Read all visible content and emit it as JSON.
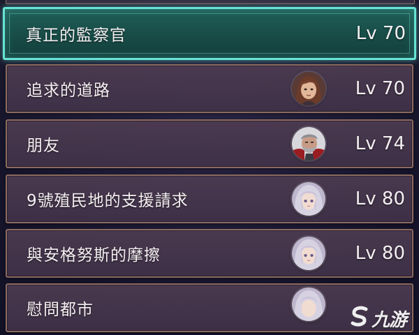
{
  "quests": [
    {
      "title": "真正的監察官",
      "level": "Lv 70",
      "selected": true,
      "portrait": "none"
    },
    {
      "title": "追求的道路",
      "level": "Lv 70",
      "selected": false,
      "portrait": "brown-haired-woman-portrait"
    },
    {
      "title": "朋友",
      "level": "Lv 74",
      "selected": false,
      "portrait": "bearded-man-portrait"
    },
    {
      "title": "9號殖民地的支援請求",
      "level": "Lv 80",
      "selected": false,
      "portrait": "silver-haired-woman-portrait"
    },
    {
      "title": "與安格努斯的摩擦",
      "level": "Lv 80",
      "selected": false,
      "portrait": "silver-haired-woman-portrait"
    },
    {
      "title": "慰問都市",
      "level": "",
      "selected": false,
      "portrait": "silver-haired-woman-portrait"
    }
  ],
  "watermark": {
    "text": "九游",
    "icon": "s-logo-icon"
  },
  "colors": {
    "selected_border": "#66e3d4",
    "item_border": "#8c6a60",
    "item_bg": "#4e3c52",
    "text": "#f4f0f2"
  }
}
